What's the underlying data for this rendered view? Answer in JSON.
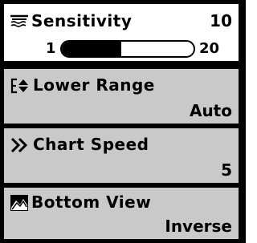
{
  "menu": {
    "items": [
      {
        "label": "Sensitivity",
        "value": "10",
        "icon": "sensitivity-icon",
        "selected": true,
        "range": {
          "min": "1",
          "max": "20",
          "level": 0.45
        }
      },
      {
        "label": "Lower Range",
        "value": "Auto",
        "icon": "up-down-arrow-icon",
        "selected": false
      },
      {
        "label": "Chart Speed",
        "value": "5",
        "icon": "double-chevron-right-icon",
        "selected": false
      },
      {
        "label": "Bottom View",
        "value": "Inverse",
        "icon": "bottom-view-icon",
        "selected": false
      }
    ]
  },
  "colors": {
    "selected_bg": "#ffffff",
    "menu_bg": "#c9c9c9",
    "border": "#000000"
  }
}
